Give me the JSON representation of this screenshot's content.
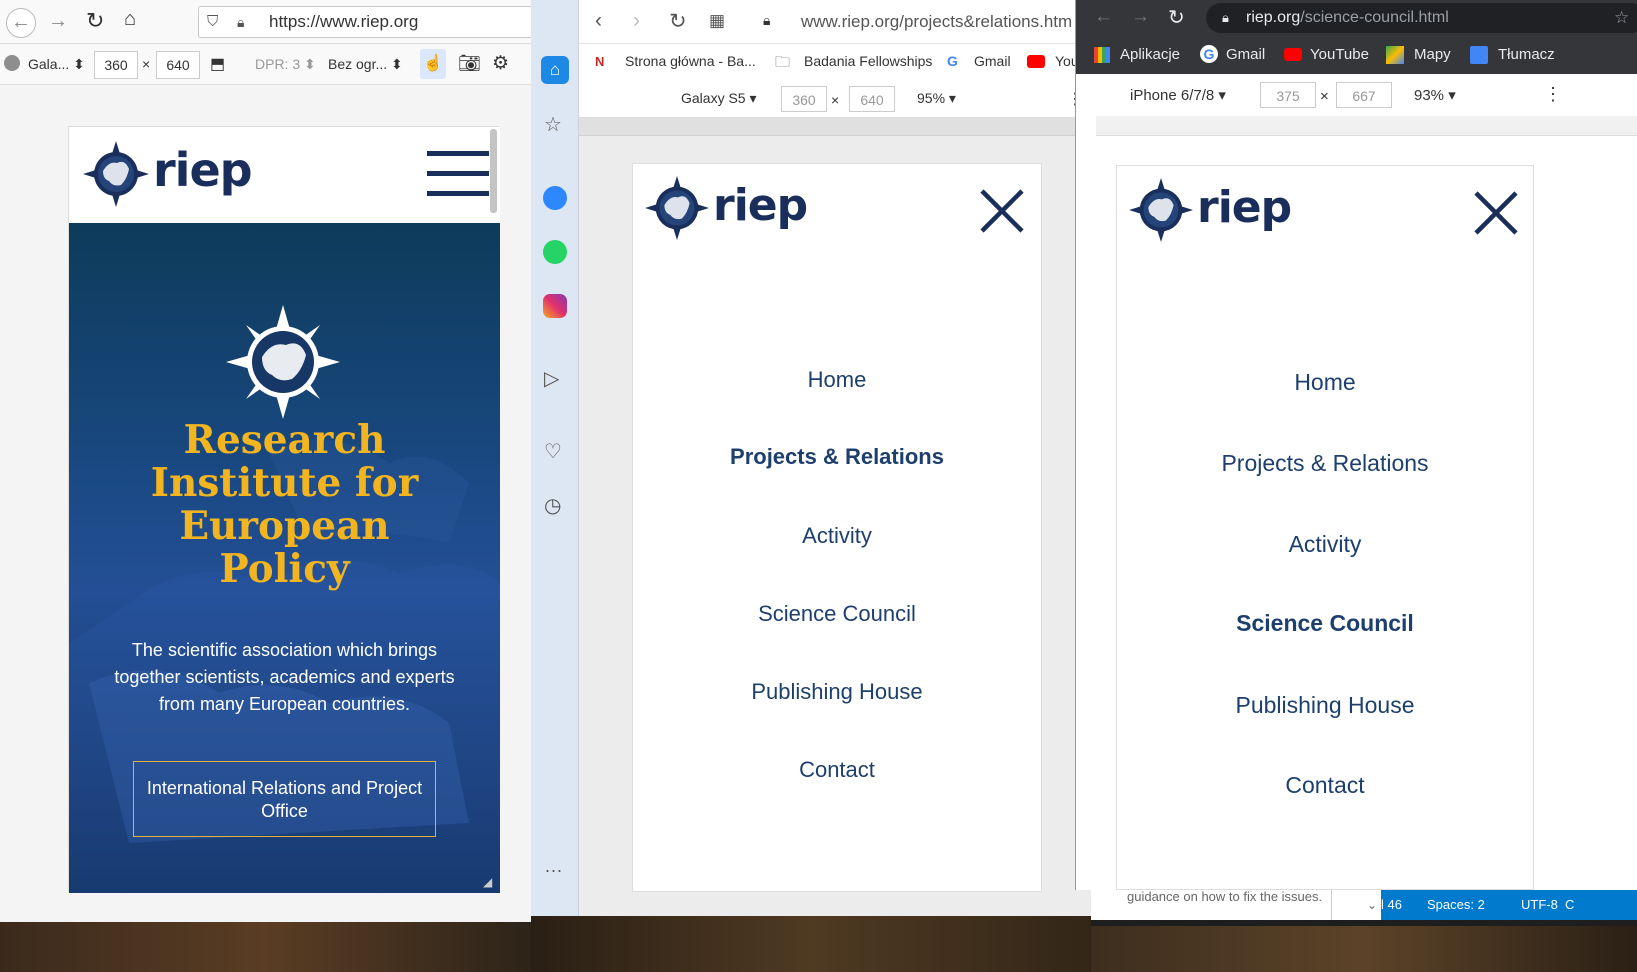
{
  "window1": {
    "url": "https://www.riep.org",
    "device": "Gala...",
    "width": "360",
    "height": "640",
    "dpr": "DPR: 3",
    "throttle": "Bez ogr...",
    "times": "×",
    "site": {
      "logo_text": "riep",
      "hero_title": "Research Institute for European Policy",
      "hero_desc": "The scientific association which brings together scientists, academics and experts from many European countries.",
      "cta_label": "International Relations and Project Office"
    }
  },
  "window2": {
    "url": "www.riep.org/projects&relations.htm",
    "bookmarks": [
      "Strona główna - Ba...",
      "Badania Fellowships",
      "Gmail",
      "You"
    ],
    "device": "Galaxy S5",
    "width": "360",
    "height": "640",
    "zoom": "95%",
    "times": "×",
    "logo_text": "riep",
    "menu": [
      "Home",
      "Projects & Relations",
      "Activity",
      "Science Council",
      "Publishing House",
      "Contact"
    ],
    "active_index": 1,
    "dots": "..."
  },
  "window3": {
    "url_prefix": "riep.org",
    "url_path": "/science-council.html",
    "bookmarks": [
      "Aplikacje",
      "Gmail",
      "YouTube",
      "Mapy",
      "Tłumacz"
    ],
    "device": "iPhone 6/7/8",
    "width": "375",
    "height": "667",
    "zoom": "93%",
    "times": "×",
    "logo_text": "riep",
    "menu": [
      "Home",
      "Projects & Relations",
      "Activity",
      "Science Council",
      "Publishing House",
      "Contact"
    ],
    "active_index": 3
  },
  "editor": {
    "hint": "guidance on how to fix the issues.",
    "col": "l 46",
    "spaces": "Spaces: 2",
    "encoding": "UTF-8",
    "extra": "C"
  },
  "colors": {
    "navy": "#1a2e5c",
    "gold": "#f3b51f",
    "menu": "#1d3f6e"
  }
}
